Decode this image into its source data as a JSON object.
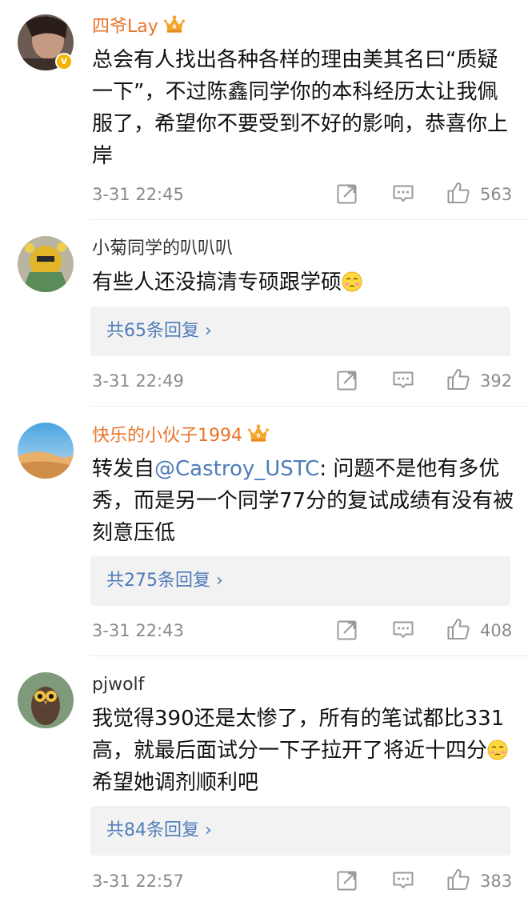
{
  "comments": [
    {
      "username": "四爷Lay",
      "text": "总会有人找出各种各样的理由美其名曰“质疑一下”，不过陈鑫同学你的本科经历太让我佩服了，希望你不要受到不好的影响，恭喜你上岸",
      "time": "3-31 22:45",
      "likes": "563"
    },
    {
      "username": "小菊同学的叭叭叭",
      "text": "有些人还没搞清专硕跟学硕",
      "replies": "共65条回复 ›",
      "time": "3-31 22:49",
      "likes": "392"
    },
    {
      "username": "快乐的小伙子1994",
      "text_prefix": "转发自",
      "mention": "@Castroy_USTC",
      "text_suffix": ": 问题不是他有多优秀，而是另一个同学77分的复试成绩有没有被刻意压低",
      "replies": "共275条回复 ›",
      "time": "3-31 22:43",
      "likes": "408"
    },
    {
      "username": "pjwolf",
      "text_a": "我觉得390还是太惨了，所有的笔试都比331高，就最后面试分一下子拉开了将近十四分",
      "text_b": " 希望她调剂顺利吧",
      "replies": "共84条回复 ›",
      "time": "3-31 22:57",
      "likes": "383"
    }
  ],
  "icons": {
    "repost": "repost-icon",
    "comment": "comment-icon",
    "like": "thumbs-up-icon",
    "vip": "crown-icon",
    "verified": "verified-badge-icon",
    "emoji": "embarrassed-smile-emoji"
  },
  "colors": {
    "vip_name": "#e8742a",
    "link": "#4f7cb8",
    "meta": "#8a8a8a",
    "reply_bg": "#f2f2f2"
  }
}
